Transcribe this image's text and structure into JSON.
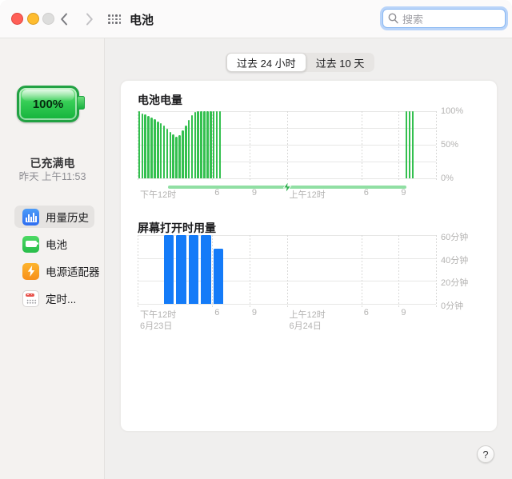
{
  "window": {
    "title": "电池"
  },
  "titlebar": {
    "search": {
      "placeholder": "搜索",
      "focus_ring_color": "#408cf5"
    }
  },
  "sidebar": {
    "battery_percent": "100%",
    "battery_color": "#2ecb4e",
    "status_title": "已充满电",
    "status_subtitle": "昨天 上午11:53",
    "items": [
      {
        "label": "用量历史",
        "icon": "usage-history-icon",
        "icon_color": "#3b82f7",
        "selected": true
      },
      {
        "label": "电池",
        "icon": "battery-icon",
        "icon_color": "#34c759",
        "selected": false
      },
      {
        "label": "电源适配器",
        "icon": "power-adapter-icon",
        "icon_color": "#f7a417",
        "selected": false
      },
      {
        "label": "定时...",
        "icon": "schedule-icon",
        "icon_color": "#ffffff",
        "selected": false
      }
    ]
  },
  "main": {
    "segmented": {
      "options": [
        "过去 24 小时",
        "过去 10 天"
      ],
      "selected_index": 0
    },
    "help_label": "?"
  },
  "chart_data": [
    {
      "type": "bar",
      "title": "电池电量",
      "color": "#34c04f",
      "bar_name": "battery-level-bar",
      "ylim": [
        0,
        100
      ],
      "ygrid": [
        0,
        25,
        50,
        75,
        100
      ],
      "yticks": [
        {
          "value": 100,
          "label": "100%"
        },
        {
          "value": 50,
          "label": "50%"
        },
        {
          "value": 0,
          "label": "0%"
        }
      ],
      "x_range_hours": 24,
      "slots": 96,
      "bar_interval_minutes": 15,
      "bar_width_ratio": 0.66,
      "xgrid_fracs": [
        0,
        0.25,
        0.375,
        0.5,
        0.75,
        0.875,
        1
      ],
      "xticks": [
        {
          "frac": 0,
          "label": "下午12时"
        },
        {
          "frac": 0.25,
          "label": "6"
        },
        {
          "frac": 0.375,
          "label": "9"
        },
        {
          "frac": 0.5,
          "label": "上午12时"
        },
        {
          "frac": 0.75,
          "label": "6"
        },
        {
          "frac": 0.875,
          "label": "9"
        }
      ],
      "segments": [
        {
          "start_slot": 0,
          "values": [
            100,
            97,
            95,
            93,
            91,
            88,
            85,
            82,
            78,
            74,
            69,
            65,
            62,
            64,
            71,
            79,
            87,
            94,
            99,
            100,
            100,
            100,
            100,
            100,
            100,
            100,
            100
          ]
        },
        {
          "start_slot": 86,
          "values": [
            100,
            100,
            100
          ]
        }
      ],
      "charging": {
        "start_frac": 0.102,
        "end_frac": 0.901,
        "line_color": "#90dfa3",
        "bolt_color": "#2fb14f"
      }
    },
    {
      "type": "bar",
      "title": "屏幕打开时用量",
      "color": "#147bf8",
      "bar_name": "screen-usage-bar",
      "ylim": [
        0,
        60
      ],
      "ygrid": [
        0,
        20,
        40,
        60
      ],
      "yticks": [
        {
          "value": 60,
          "label": "60分钟"
        },
        {
          "value": 40,
          "label": "40分钟"
        },
        {
          "value": 20,
          "label": "20分钟"
        },
        {
          "value": 0,
          "label": "0分钟"
        }
      ],
      "x_range_hours": 24,
      "slots": 24,
      "bar_interval_minutes": 60,
      "bar_width_ratio": 0.8,
      "xgrid_fracs": [
        0,
        0.25,
        0.375,
        0.5,
        0.75,
        0.875,
        1
      ],
      "xticks": [
        {
          "frac": 0,
          "label": "下午12时"
        },
        {
          "frac": 0.25,
          "label": "6"
        },
        {
          "frac": 0.375,
          "label": "9"
        },
        {
          "frac": 0.5,
          "label": "上午12时"
        },
        {
          "frac": 0.75,
          "label": "6"
        },
        {
          "frac": 0.875,
          "label": "9"
        }
      ],
      "xdates": [
        {
          "frac": 0,
          "label": "6月23日"
        },
        {
          "frac": 0.5,
          "label": "6月24日"
        }
      ],
      "segments": [
        {
          "start_slot": 2,
          "values": [
            60,
            60,
            60,
            60,
            48
          ]
        }
      ]
    }
  ]
}
